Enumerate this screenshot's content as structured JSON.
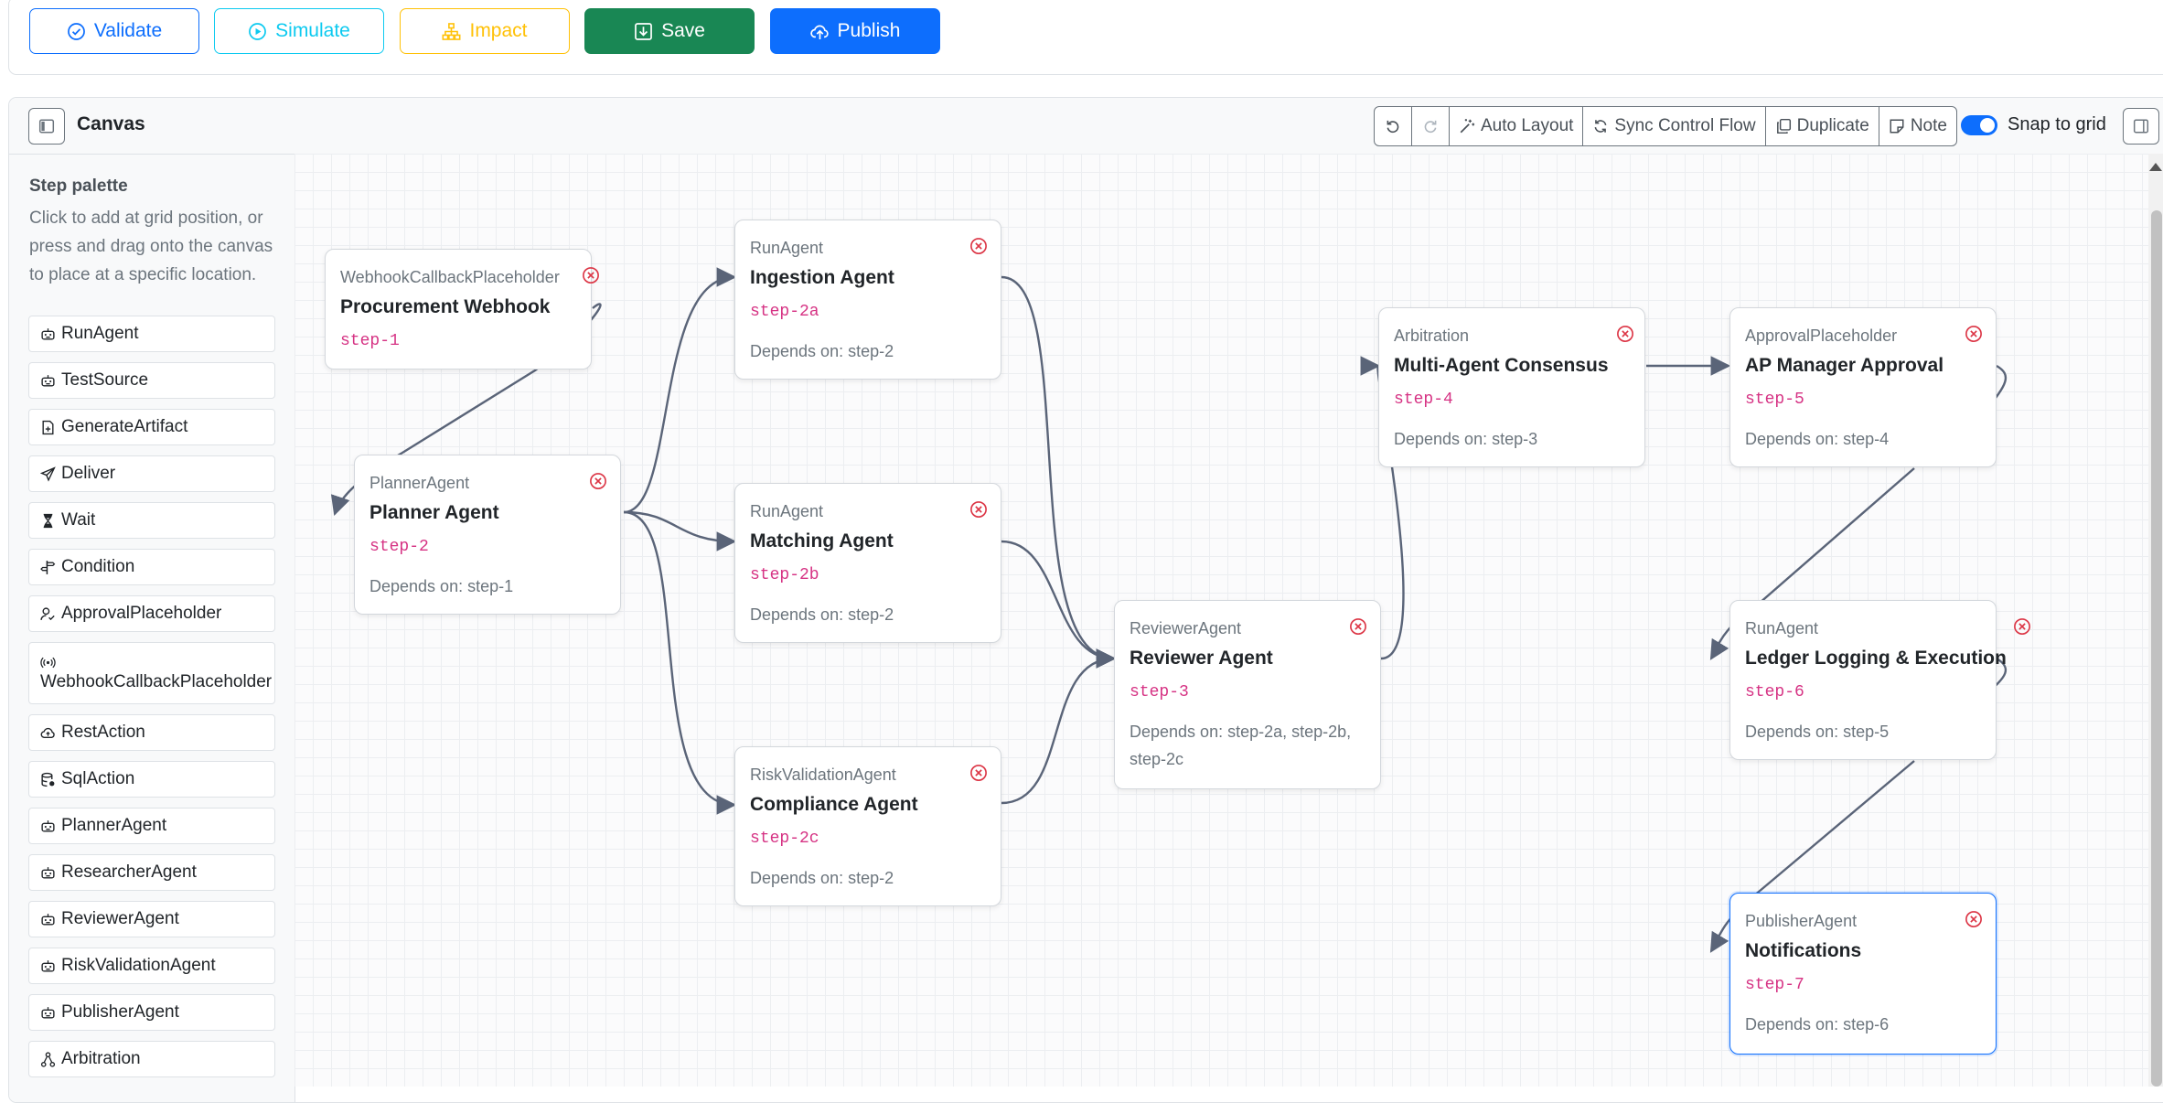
{
  "toolbar": {
    "validate": "Validate",
    "simulate": "Simulate",
    "impact": "Impact",
    "save": "Save",
    "publish": "Publish"
  },
  "canvas": {
    "title": "Canvas",
    "actions": [
      "Auto Layout",
      "Sync Control Flow",
      "Duplicate",
      "Note"
    ],
    "snap_label": "Snap to grid",
    "snap_enabled": true
  },
  "palette": {
    "title": "Step palette",
    "help": "Click to add at grid position, or press and drag onto the canvas to place at a specific location.",
    "items": [
      {
        "label": "RunAgent",
        "icon": "robot-icon"
      },
      {
        "label": "TestSource",
        "icon": "robot-icon"
      },
      {
        "label": "GenerateArtifact",
        "icon": "file-plus-icon"
      },
      {
        "label": "Deliver",
        "icon": "send-icon"
      },
      {
        "label": "Wait",
        "icon": "hourglass-icon"
      },
      {
        "label": "Condition",
        "icon": "signpost-icon"
      },
      {
        "label": "ApprovalPlaceholder",
        "icon": "person-check-icon"
      },
      {
        "label": "WebhookCallbackPlaceholder",
        "icon": "broadcast-icon"
      },
      {
        "label": "RestAction",
        "icon": "cloud-icon"
      },
      {
        "label": "SqlAction",
        "icon": "database-icon"
      },
      {
        "label": "PlannerAgent",
        "icon": "robot-icon"
      },
      {
        "label": "ResearcherAgent",
        "icon": "robot-icon"
      },
      {
        "label": "ReviewerAgent",
        "icon": "robot-icon"
      },
      {
        "label": "RiskValidationAgent",
        "icon": "robot-icon"
      },
      {
        "label": "PublisherAgent",
        "icon": "robot-icon"
      },
      {
        "label": "Arbitration",
        "icon": "diagram-icon"
      }
    ]
  },
  "nodes": [
    {
      "type": "WebhookCallbackPlaceholder",
      "title": "Procurement Webhook",
      "id": "step-1",
      "deps": ""
    },
    {
      "type": "PlannerAgent",
      "title": "Planner Agent",
      "id": "step-2",
      "deps": "Depends on: step-1"
    },
    {
      "type": "RunAgent",
      "title": "Ingestion Agent",
      "id": "step-2a",
      "deps": "Depends on: step-2"
    },
    {
      "type": "RunAgent",
      "title": "Matching Agent",
      "id": "step-2b",
      "deps": "Depends on: step-2"
    },
    {
      "type": "RiskValidationAgent",
      "title": "Compliance Agent",
      "id": "step-2c",
      "deps": "Depends on: step-2"
    },
    {
      "type": "ReviewerAgent",
      "title": "Reviewer Agent",
      "id": "step-3",
      "deps": "Depends on: step-2a, step-2b, step-2c"
    },
    {
      "type": "Arbitration",
      "title": "Multi-Agent Consensus",
      "id": "step-4",
      "deps": "Depends on: step-3"
    },
    {
      "type": "ApprovalPlaceholder",
      "title": "AP Manager Approval",
      "id": "step-5",
      "deps": "Depends on: step-4"
    },
    {
      "type": "RunAgent",
      "title": "Ledger Logging & Execution",
      "id": "step-6",
      "deps": "Depends on: step-5"
    },
    {
      "type": "PublisherAgent",
      "title": "Notifications",
      "id": "step-7",
      "deps": "Depends on: step-6"
    }
  ],
  "colors": {
    "primary": "#0d6efd",
    "info": "#0dcaf0",
    "warning": "#ffc107",
    "success": "#198754",
    "danger": "#dc3545",
    "step_id": "#d63384",
    "edge": "#5a6478"
  }
}
